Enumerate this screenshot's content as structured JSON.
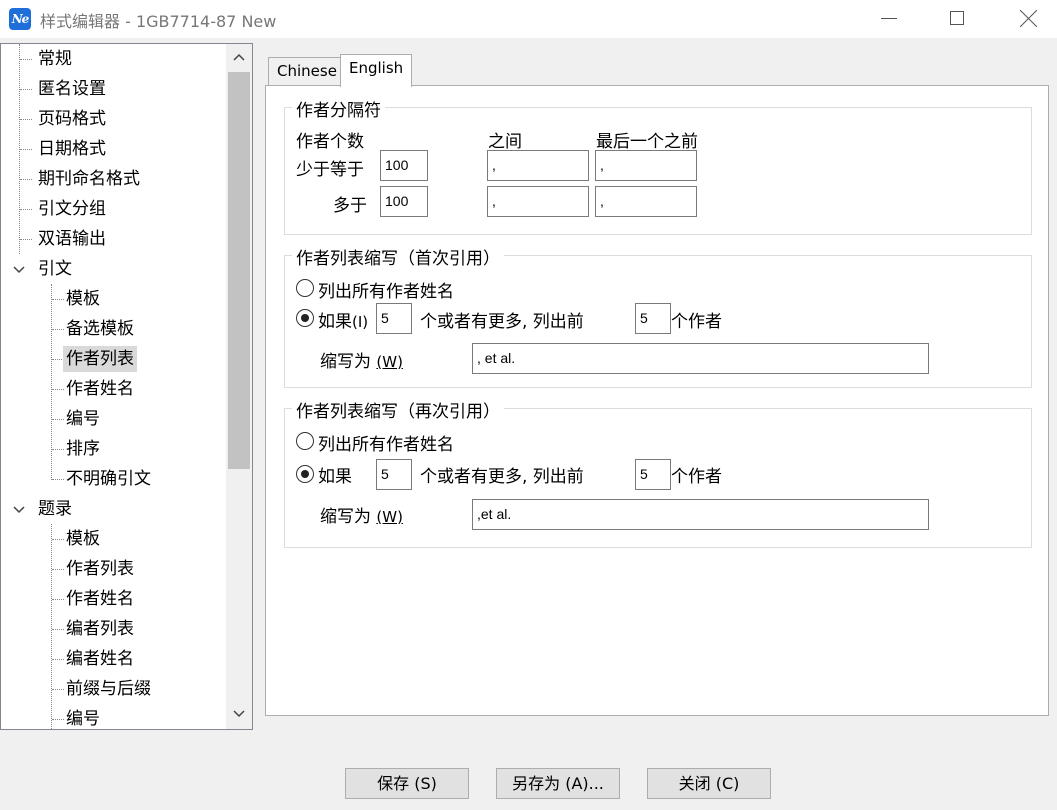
{
  "window": {
    "title": "样式编辑器 - 1GB7714-87 New",
    "icon_text": "Ne",
    "icon_name": "endnote-app-icon"
  },
  "tree": {
    "items": [
      {
        "label": "常规",
        "level": 0
      },
      {
        "label": "匿名设置",
        "level": 0
      },
      {
        "label": "页码格式",
        "level": 0
      },
      {
        "label": "日期格式",
        "level": 0
      },
      {
        "label": "期刊命名格式",
        "level": 0
      },
      {
        "label": "引文分组",
        "level": 0
      },
      {
        "label": "双语输出",
        "level": 0
      },
      {
        "label": "引文",
        "level": 0,
        "expanded": true
      },
      {
        "label": "模板",
        "level": 1
      },
      {
        "label": "备选模板",
        "level": 1
      },
      {
        "label": "作者列表",
        "level": 1,
        "selected": true
      },
      {
        "label": "作者姓名",
        "level": 1
      },
      {
        "label": "编号",
        "level": 1
      },
      {
        "label": "排序",
        "level": 1
      },
      {
        "label": "不明确引文",
        "level": 1
      },
      {
        "label": "题录",
        "level": 0,
        "expanded": true
      },
      {
        "label": "模板",
        "level": 1
      },
      {
        "label": "作者列表",
        "level": 1
      },
      {
        "label": "作者姓名",
        "level": 1
      },
      {
        "label": "编者列表",
        "level": 1
      },
      {
        "label": "编者姓名",
        "level": 1
      },
      {
        "label": "前缀与后缀",
        "level": 1
      },
      {
        "label": "编号",
        "level": 1
      }
    ]
  },
  "tabs": [
    {
      "label": "Chinese",
      "active": false
    },
    {
      "label": "English",
      "active": true
    }
  ],
  "separators": {
    "legend": "作者分隔符",
    "author_count_label": "作者个数",
    "between_label": "之间",
    "before_last_label": "最后一个之前",
    "rows": [
      {
        "label": "少于等于",
        "count": "100",
        "between": ",",
        "before_last": ","
      },
      {
        "label": "多于",
        "count": "100",
        "between": ",",
        "before_last": ","
      }
    ]
  },
  "first_cite": {
    "legend": "作者列表缩写（首次引用）",
    "option_list_all": "列出所有作者姓名",
    "option_if_prefix": "如果",
    "option_if_hotkey": "(I)",
    "min_authors": "5",
    "middle_text": "个或者有更多, 列出前",
    "list_first": "5",
    "suffix_text": "个作者",
    "abbrev_label": "缩写为",
    "abbrev_hotkey": "(W)",
    "abbrev_value": ", et al.",
    "selected": "if"
  },
  "subsequent_cite": {
    "legend": "作者列表缩写（再次引用）",
    "option_list_all": "列出所有作者姓名",
    "option_if_prefix": "如果",
    "min_authors": "5",
    "middle_text": "个或者有更多, 列出前",
    "list_first": "5",
    "suffix_text": "个作者",
    "abbrev_label": "缩写为",
    "abbrev_hotkey": "(W)",
    "abbrev_value": ",et al.",
    "selected": "if"
  },
  "buttons": {
    "save": "保存 (S)",
    "save_as": "另存为 (A)...",
    "close": "关闭 (C)"
  }
}
